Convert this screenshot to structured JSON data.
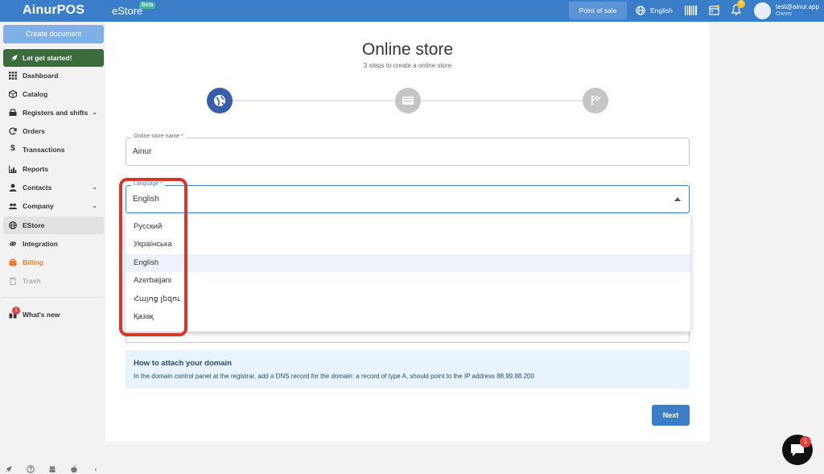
{
  "topbar": {
    "logo": "AinurPOS",
    "section": "eStore",
    "section_badge": "Beta",
    "point_of_sale": "Point of sale",
    "language": "English",
    "notifications_count": "5",
    "user_email": "test@ainur.app",
    "user_role": "Owner"
  },
  "sidebar": {
    "create_document": "Create document",
    "get_started": "Let get started!",
    "items": [
      {
        "label": "Dashboard",
        "icon": "grid-icon"
      },
      {
        "label": "Catalog",
        "icon": "box-icon"
      },
      {
        "label": "Registers and shifts",
        "icon": "register-icon",
        "chevron": "⌄"
      },
      {
        "label": "Orders",
        "icon": "refresh-icon"
      },
      {
        "label": "Transactions",
        "icon": "dollar-icon"
      },
      {
        "label": "Reports",
        "icon": "chart-icon"
      },
      {
        "label": "Contacts",
        "icon": "person-icon",
        "chevron": "⌄"
      },
      {
        "label": "Company",
        "icon": "people-icon",
        "chevron": "⌄"
      },
      {
        "label": "EStore",
        "icon": "globe-icon"
      },
      {
        "label": "Integration",
        "icon": "link-icon"
      },
      {
        "label": "Billing",
        "icon": "billing-icon"
      },
      {
        "label": "Trash",
        "icon": "trash-icon"
      }
    ],
    "whats_new": "What's new",
    "whats_new_count": "1",
    "bottom": {
      "collapse": "‹"
    }
  },
  "main": {
    "title": "Online store",
    "subtitle": "3 steps to create a online store",
    "store_name_label": "Online store name *",
    "store_name_value": "Ainur",
    "language_label": "Language *",
    "language_value": "English",
    "language_options": [
      "Русский",
      "Українська",
      "English",
      "Azerbaijani",
      "Հայոց լեզու",
      "Қазақ"
    ],
    "info_title": "How to attach your domain",
    "info_text": "In the domain control panel at the registrar, add a DNS record for the domain: a record of type A, should point to the IP address 88.99.88.200",
    "next": "Next"
  },
  "chat": {
    "count": "1"
  },
  "colors": {
    "primary": "#3a7ec9",
    "started_bg": "#3c6b3d",
    "highlight": "#d13a2a",
    "billing": "#e57b2b"
  }
}
